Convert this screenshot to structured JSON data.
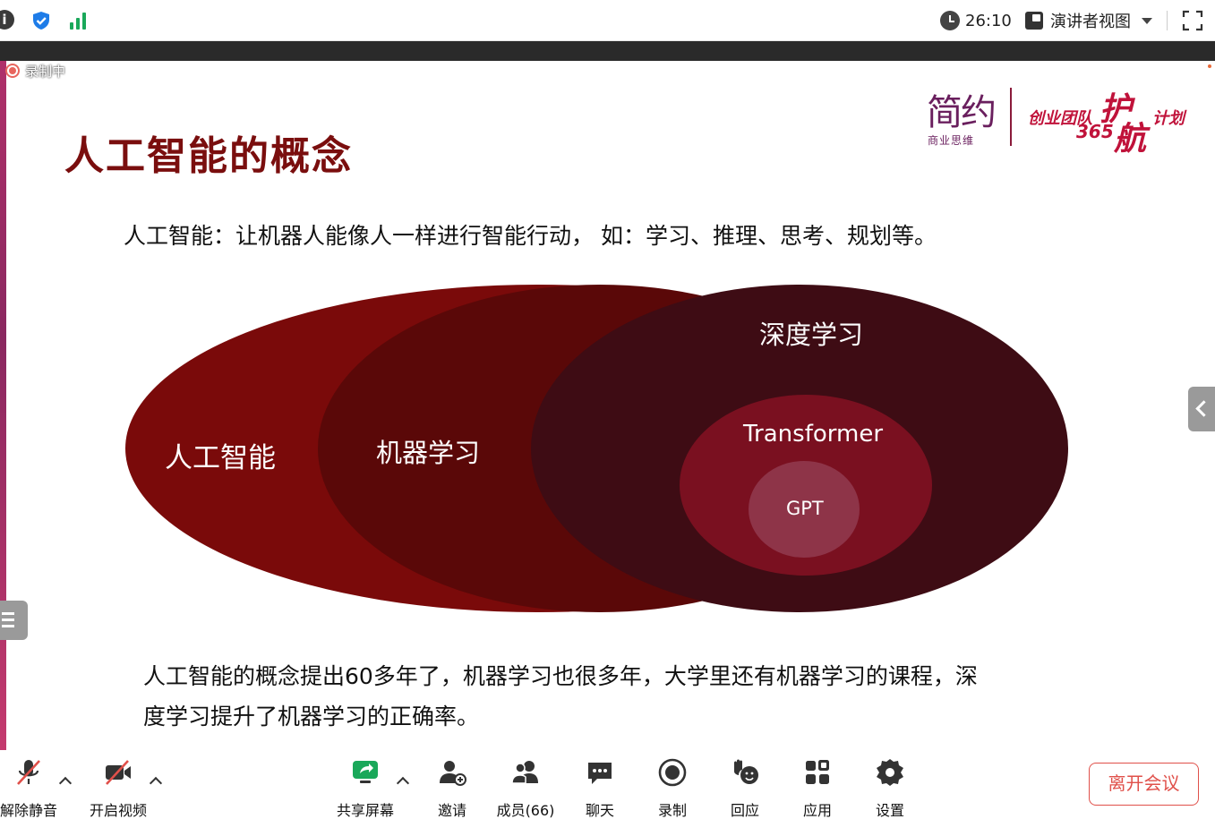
{
  "topbar": {
    "info_icon": "i",
    "timer": "26:10",
    "view_mode": "演讲者视图"
  },
  "recording": {
    "label": "录制中"
  },
  "slide": {
    "title": "人工智能的概念",
    "logo": {
      "brand": "简约",
      "brand_sub": "商业思维",
      "plan_part1": "创业团队",
      "plan_hu": "护",
      "plan_num": "365",
      "plan_hang": "航",
      "plan_part2": "计划"
    },
    "definition": "人工智能：让机器人能像人一样进行智能行动， 如：学习、推理、思考、规划等。",
    "venn": {
      "ai": "人工智能",
      "ml": "机器学习",
      "dl": "深度学习",
      "transformer": "Transformer",
      "gpt": "GPT"
    },
    "summary": "人工智能的概念提出60多年了，机器学习也很多年，大学里还有机器学习的课程，深度学习提升了机器学习的正确率。"
  },
  "toolbar": {
    "unmute": "解除静音",
    "start_video": "开启视频",
    "share_screen": "共享屏幕",
    "invite": "邀请",
    "members": "成员(66)",
    "chat": "聊天",
    "record": "录制",
    "reactions": "回应",
    "apps": "应用",
    "settings": "设置",
    "leave": "离开会议"
  },
  "colors": {
    "title": "#7a0e0e",
    "ai_ellipse": "#7a0a0a",
    "ml_ellipse": "#5a0808",
    "dl_ellipse": "#3e0c14",
    "transformer_ellipse": "#7a1020",
    "gpt_ellipse": "#8e3448",
    "leave": "#e0504a",
    "share_green": "#1aa85a"
  }
}
